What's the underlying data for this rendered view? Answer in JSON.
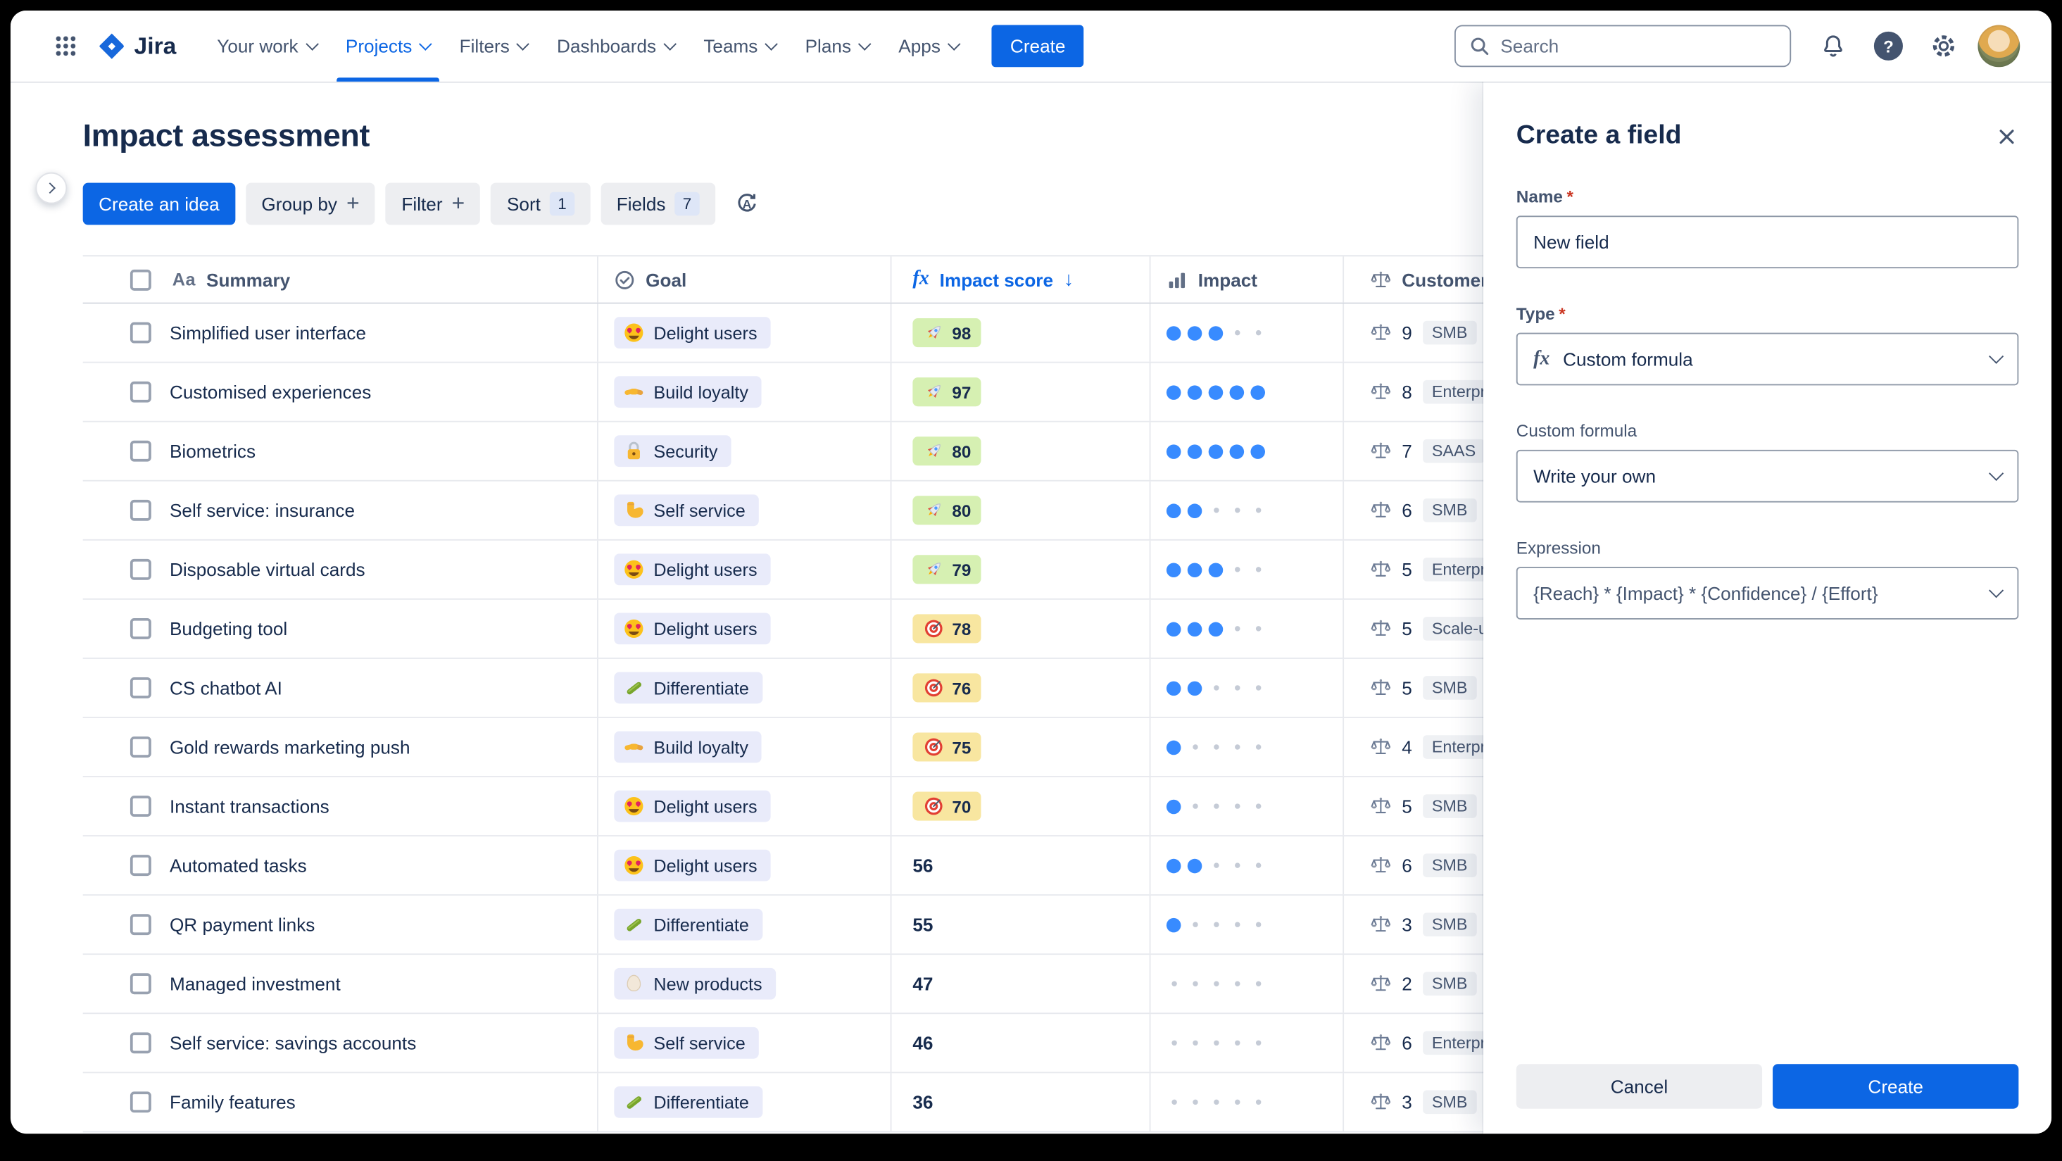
{
  "nav": {
    "logo_text": "Jira",
    "items": [
      {
        "label": "Your work"
      },
      {
        "label": "Projects",
        "active": true
      },
      {
        "label": "Filters"
      },
      {
        "label": "Dashboards"
      },
      {
        "label": "Teams"
      },
      {
        "label": "Plans"
      },
      {
        "label": "Apps"
      }
    ],
    "create_label": "Create",
    "search_placeholder": "Search"
  },
  "page": {
    "title": "Impact assessment"
  },
  "toolbar": {
    "create_idea": "Create an idea",
    "group_by": "Group by",
    "filter": "Filter",
    "sort": "Sort",
    "sort_count": "1",
    "fields": "Fields",
    "fields_count": "7"
  },
  "table": {
    "headers": {
      "summary": "Summary",
      "goal": "Goal",
      "impact_score": "Impact score",
      "impact": "Impact",
      "customer": "Customer"
    },
    "rows": [
      {
        "summary": "Simplified user interface",
        "goal": {
          "icon": "delight",
          "label": "Delight users"
        },
        "score": {
          "value": "98",
          "style": "green",
          "icon": "rocket"
        },
        "impact": 3,
        "customer": {
          "count": "9",
          "tag": "SMB"
        }
      },
      {
        "summary": "Customised experiences",
        "goal": {
          "icon": "handshake",
          "label": "Build loyalty"
        },
        "score": {
          "value": "97",
          "style": "green",
          "icon": "rocket"
        },
        "impact": 5,
        "customer": {
          "count": "8",
          "tag": "Enterprise"
        }
      },
      {
        "summary": "Biometrics",
        "goal": {
          "icon": "lock",
          "label": "Security"
        },
        "score": {
          "value": "80",
          "style": "green",
          "icon": "rocket"
        },
        "impact": 5,
        "customer": {
          "count": "7",
          "tag": "SAAS"
        }
      },
      {
        "summary": "Self service: insurance",
        "goal": {
          "icon": "muscle",
          "label": "Self service"
        },
        "score": {
          "value": "80",
          "style": "green",
          "icon": "rocket"
        },
        "impact": 2,
        "customer": {
          "count": "6",
          "tag": "SMB"
        }
      },
      {
        "summary": "Disposable virtual cards",
        "goal": {
          "icon": "delight",
          "label": "Delight users"
        },
        "score": {
          "value": "79",
          "style": "green",
          "icon": "rocket"
        },
        "impact": 3,
        "customer": {
          "count": "5",
          "tag": "Enterprise"
        }
      },
      {
        "summary": "Budgeting tool",
        "goal": {
          "icon": "delight",
          "label": "Delight users"
        },
        "score": {
          "value": "78",
          "style": "yellow",
          "icon": "target"
        },
        "impact": 3,
        "customer": {
          "count": "5",
          "tag": "Scale-ups"
        }
      },
      {
        "summary": "CS chatbot AI",
        "goal": {
          "icon": "cucumber",
          "label": "Differentiate"
        },
        "score": {
          "value": "76",
          "style": "yellow",
          "icon": "target"
        },
        "impact": 2,
        "customer": {
          "count": "5",
          "tag": "SMB"
        }
      },
      {
        "summary": "Gold rewards marketing push",
        "goal": {
          "icon": "handshake",
          "label": "Build loyalty"
        },
        "score": {
          "value": "75",
          "style": "yellow",
          "icon": "target"
        },
        "impact": 1,
        "customer": {
          "count": "4",
          "tag": "Enterprise"
        }
      },
      {
        "summary": "Instant transactions",
        "goal": {
          "icon": "delight",
          "label": "Delight users"
        },
        "score": {
          "value": "70",
          "style": "yellow",
          "icon": "target"
        },
        "impact": 1,
        "customer": {
          "count": "5",
          "tag": "SMB"
        }
      },
      {
        "summary": "Automated tasks",
        "goal": {
          "icon": "delight",
          "label": "Delight users"
        },
        "score": {
          "value": "56",
          "style": "plain"
        },
        "impact": 2,
        "customer": {
          "count": "6",
          "tag": "SMB"
        }
      },
      {
        "summary": "QR payment links",
        "goal": {
          "icon": "cucumber",
          "label": "Differentiate"
        },
        "score": {
          "value": "55",
          "style": "plain"
        },
        "impact": 1,
        "customer": {
          "count": "3",
          "tag": "SMB"
        }
      },
      {
        "summary": "Managed investment",
        "goal": {
          "icon": "egg",
          "label": "New products"
        },
        "score": {
          "value": "47",
          "style": "plain"
        },
        "impact": 0,
        "customer": {
          "count": "2",
          "tag": "SMB"
        }
      },
      {
        "summary": "Self service: savings accounts",
        "goal": {
          "icon": "muscle",
          "label": "Self service"
        },
        "score": {
          "value": "46",
          "style": "plain"
        },
        "impact": 0,
        "customer": {
          "count": "6",
          "tag": "Enterprise"
        }
      },
      {
        "summary": "Family features",
        "goal": {
          "icon": "cucumber",
          "label": "Differentiate"
        },
        "score": {
          "value": "36",
          "style": "plain"
        },
        "impact": 0,
        "customer": {
          "count": "3",
          "tag": "SMB"
        }
      }
    ]
  },
  "panel": {
    "title": "Create a field",
    "name_label": "Name",
    "name_value": "New field",
    "type_label": "Type",
    "type_value": "Custom formula",
    "formula_label": "Custom formula",
    "formula_value": "Write your own",
    "expression_label": "Expression",
    "expression_value": "{Reach} * {Impact} * {Confidence} / {Effort}",
    "cancel_label": "Cancel",
    "create_label": "Create"
  },
  "colors": {
    "accent_blue": "#0C66E4",
    "score_chip_green": "#D6F0B2",
    "score_chip_yellow": "#F8E6A0",
    "impact_dot_blue": "#388BFF",
    "goal_pill": "#E9EBFA"
  }
}
